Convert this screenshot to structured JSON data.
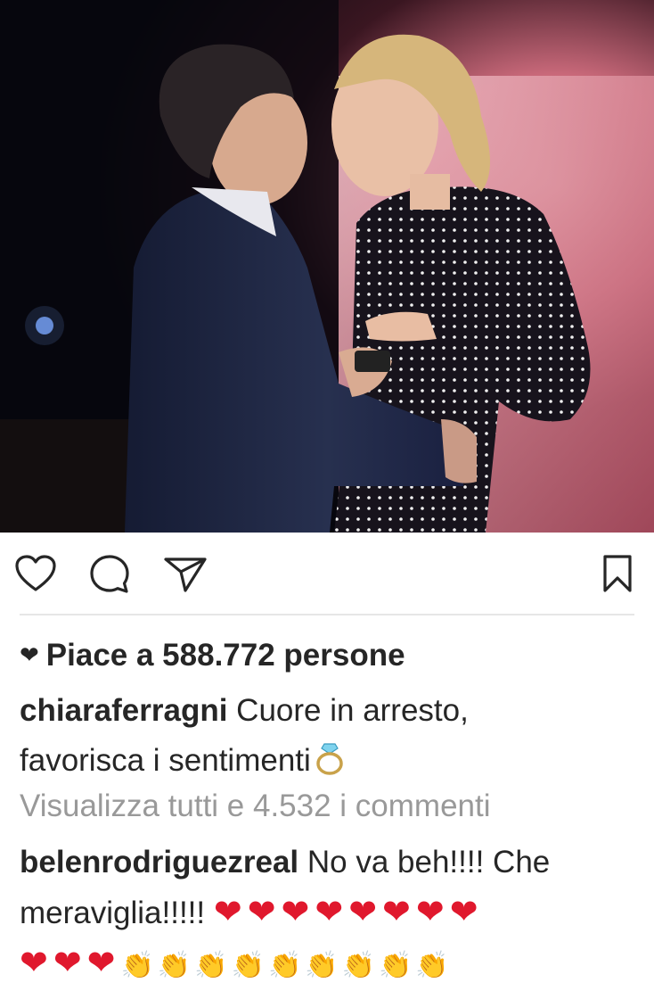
{
  "post": {
    "likes_text": "Piace a 588.772 persone",
    "author": "chiaraferragni",
    "caption_line1": "Cuore in arresto,",
    "caption_line2": "favorisca i sentimenti",
    "caption_emoji": "ring-emoji",
    "view_all_comments": "Visualizza tutti e 4.532 i commenti",
    "comment": {
      "author": "belenrodriguezreal",
      "text_line1": "No va beh!!!! Che",
      "text_line2": "meraviglia!!!!!",
      "hearts_line2": "❤❤❤❤❤❤❤❤",
      "hearts_line3": "❤❤❤",
      "claps_line3": "👏👏👏👏👏👏👏👏👏"
    }
  },
  "icons": {
    "like": "heart-outline-icon",
    "comment": "comment-bubble-icon",
    "share": "paper-plane-icon",
    "save": "bookmark-icon",
    "likes_prefix": "small-heart-icon"
  },
  "colors": {
    "text": "#262626",
    "muted": "#999999",
    "heart_emoji": "#e0182d",
    "divider": "#e6e6e6"
  }
}
